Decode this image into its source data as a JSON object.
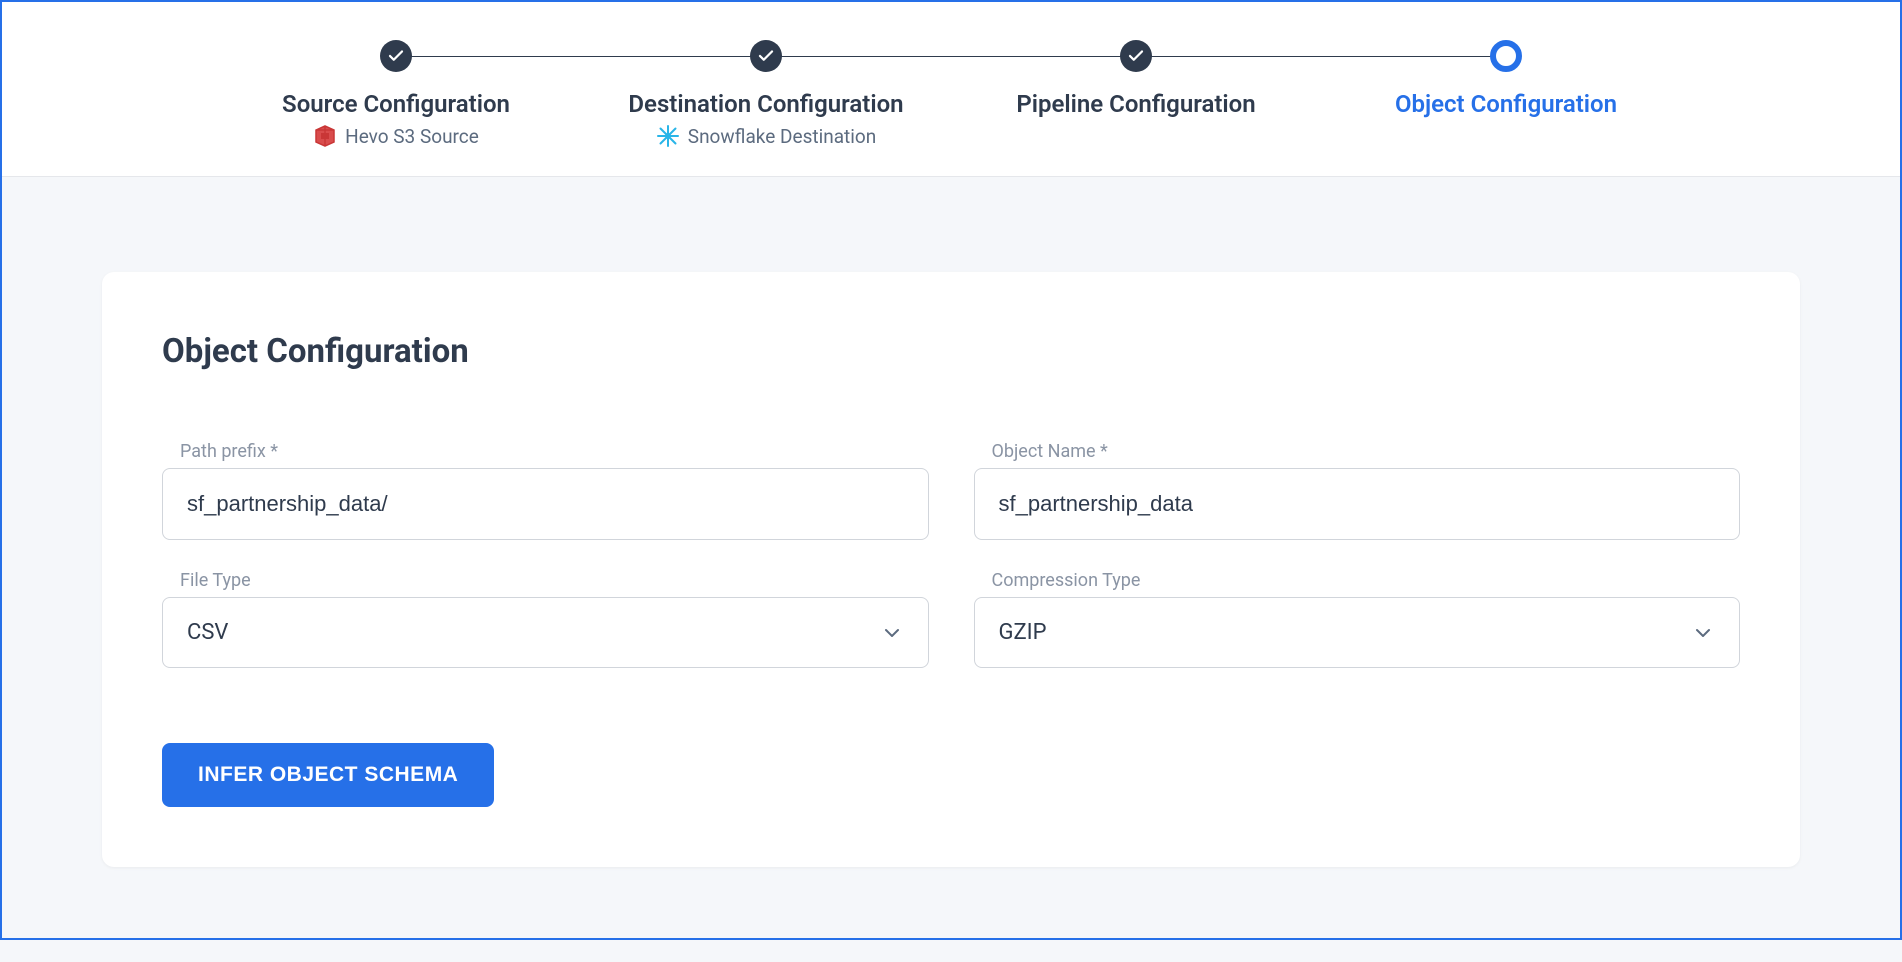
{
  "stepper": {
    "steps": [
      {
        "label": "Source Configuration",
        "sublabel": "Hevo S3 Source",
        "status": "completed",
        "icon": "s3"
      },
      {
        "label": "Destination Configuration",
        "sublabel": "Snowflake Destination",
        "status": "completed",
        "icon": "snowflake"
      },
      {
        "label": "Pipeline Configuration",
        "sublabel": "",
        "status": "completed",
        "icon": ""
      },
      {
        "label": "Object Configuration",
        "sublabel": "",
        "status": "active",
        "icon": ""
      }
    ]
  },
  "card": {
    "title": "Object Configuration"
  },
  "form": {
    "path_prefix": {
      "label": "Path prefix *",
      "value": "sf_partnership_data/"
    },
    "object_name": {
      "label": "Object Name *",
      "value": "sf_partnership_data"
    },
    "file_type": {
      "label": "File Type",
      "value": "CSV"
    },
    "compression_type": {
      "label": "Compression Type",
      "value": "GZIP"
    }
  },
  "actions": {
    "infer_schema_label": "INFER OBJECT SCHEMA"
  }
}
